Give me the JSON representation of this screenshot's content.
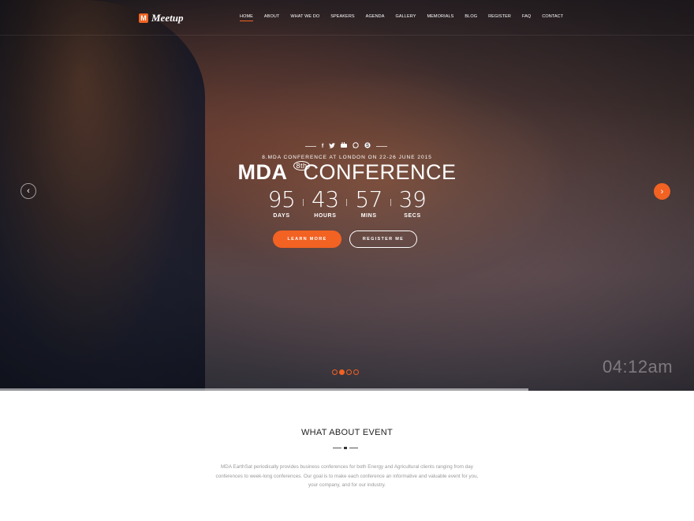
{
  "brand": {
    "logo_letter": "M",
    "name": "Meetup"
  },
  "nav": {
    "items": [
      {
        "label": "HOME",
        "active": true
      },
      {
        "label": "ABOUT"
      },
      {
        "label": "WHAT WE DO"
      },
      {
        "label": "SPEAKERS"
      },
      {
        "label": "AGENDA"
      },
      {
        "label": "GALLERY"
      },
      {
        "label": "MEMORIALS"
      },
      {
        "label": "BLOG"
      },
      {
        "label": "REGISTER"
      },
      {
        "label": "FAQ"
      },
      {
        "label": "CONTACT"
      }
    ]
  },
  "social_icons": [
    "facebook-icon",
    "twitter-icon",
    "youtube-icon",
    "whatsapp-icon",
    "skype-icon"
  ],
  "hero": {
    "subtitle": "8.MDA CONFERENCE AT LONDON ON 22-26 JUNE 2015",
    "title_bold": "MDA",
    "title_sup": "8th",
    "title_light": "CONFERENCE",
    "countdown": [
      {
        "value": "95",
        "label": "DAYS"
      },
      {
        "value": "43",
        "label": "HOURS"
      },
      {
        "value": "57",
        "label": "MINS"
      },
      {
        "value": "39",
        "label": "SECS"
      }
    ],
    "learn_more": "LEARN MORE",
    "register": "REGISTER ME",
    "clock": "04:12am",
    "slides": 4,
    "active_slide": 2
  },
  "about": {
    "heading": "WHAT ABOUT EVENT",
    "body": "MDA EarthSat periodically provides business conferences for both Energy and Agricultural clients ranging from day conferences to week-long conferences. Our goal is to make each conference an informative and valuable event for you, your company, and for our industry."
  },
  "colors": {
    "accent": "#f26222"
  }
}
